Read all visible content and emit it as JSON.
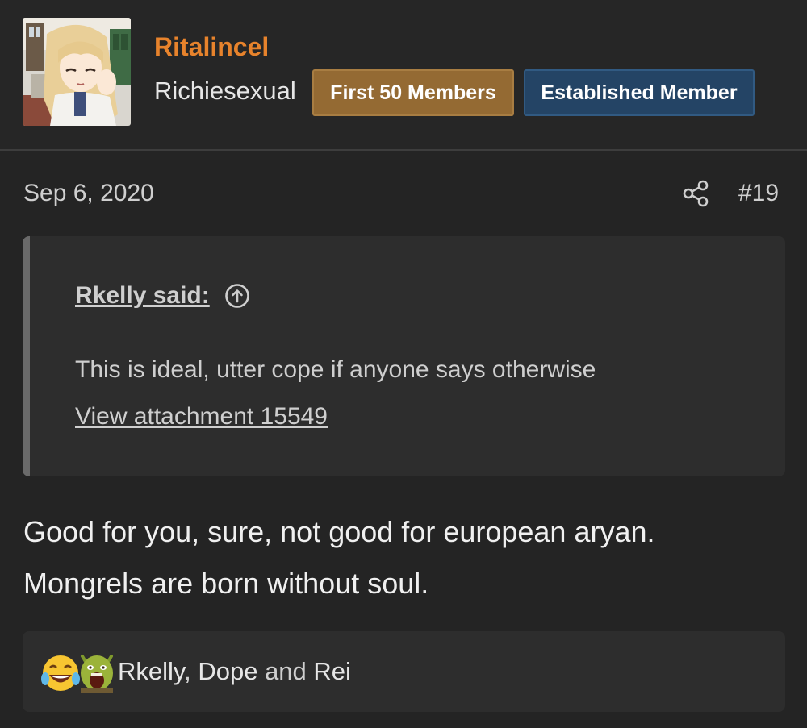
{
  "user": {
    "name": "Ritalincel",
    "title": "Richiesexual",
    "badges": [
      {
        "label": "First 50 Members",
        "color": "#946a33"
      },
      {
        "label": "Established Member",
        "color": "#244465"
      }
    ],
    "name_color": "#e7832c"
  },
  "post": {
    "date": "Sep 6, 2020",
    "number": "#19",
    "share_icon": "share-icon",
    "quote": {
      "author": "Rkelly said:",
      "jump_icon": "arrow-up-circle-icon",
      "text": "This is ideal, utter cope if anyone says otherwise",
      "attachment_link": "View attachment 15549"
    },
    "body": {
      "line1": "Good for you, sure, not good for european aryan.",
      "line2": "Mongrels are born without soul."
    }
  },
  "reactions": {
    "icons": [
      "laughing-crying-emoji-icon",
      "shrek-screaming-emoji-icon"
    ],
    "users": [
      "Rkelly",
      "Dope",
      "Rei"
    ],
    "separator": ", ",
    "conjunction": " and "
  }
}
